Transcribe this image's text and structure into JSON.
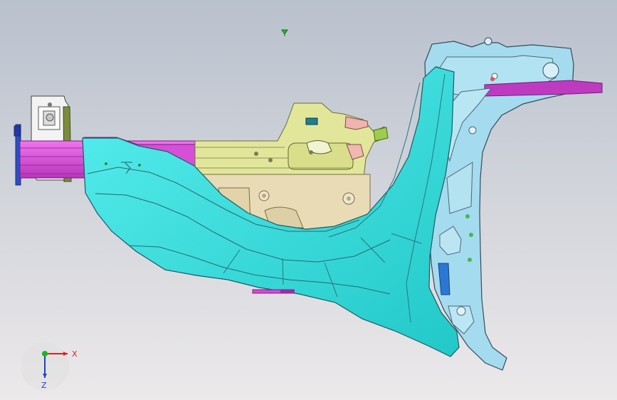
{
  "viewport": {
    "background_top": "#b9c1cd",
    "background_bottom": "#ece9ea"
  },
  "colors": {
    "cyan_surface": "#30dcd8",
    "cyan_dark": "#1ab7b7",
    "magenta_part": "#d44ad6",
    "yellow_part": "#e6e59a",
    "beige_part": "#e8dcb8",
    "light_blue_part": "#a9def0",
    "outline": "#263238"
  },
  "triad": {
    "x_label": "X",
    "z_label": "Z",
    "x_color": "#e02020",
    "y_color": "#18b820",
    "z_color": "#2040d8"
  },
  "icons": {
    "view_marker": "green-triangle-marker-icon"
  }
}
